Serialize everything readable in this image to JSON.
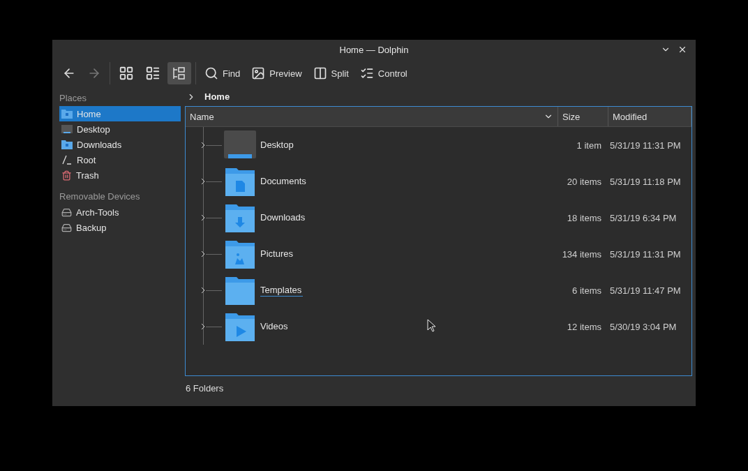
{
  "window": {
    "title": "Home — Dolphin"
  },
  "toolbar": {
    "nav": [
      {
        "kind": "back",
        "disabled": false
      },
      {
        "kind": "forward",
        "disabled": true
      }
    ],
    "views": [
      {
        "kind": "icons",
        "selected": false
      },
      {
        "kind": "compact",
        "selected": false
      },
      {
        "kind": "details",
        "selected": true
      }
    ],
    "actions": [
      {
        "kind": "find",
        "label": "Find"
      },
      {
        "kind": "preview",
        "label": "Preview"
      },
      {
        "kind": "split",
        "label": "Split"
      },
      {
        "kind": "control",
        "label": "Control"
      }
    ]
  },
  "sidebar": {
    "sections": [
      {
        "title": "Places",
        "items": [
          {
            "kind": "home",
            "label": "Home",
            "selected": true
          },
          {
            "kind": "desktop",
            "label": "Desktop",
            "selected": false
          },
          {
            "kind": "downloads",
            "label": "Downloads",
            "selected": false
          },
          {
            "kind": "root",
            "label": "Root",
            "selected": false
          },
          {
            "kind": "trash",
            "label": "Trash",
            "selected": false
          }
        ]
      },
      {
        "title": "Removable Devices",
        "items": [
          {
            "kind": "drive",
            "label": "Arch-Tools",
            "selected": false
          },
          {
            "kind": "drive",
            "label": "Backup",
            "selected": false
          }
        ]
      }
    ]
  },
  "breadcrumb": [
    "Home"
  ],
  "table": {
    "columns": [
      "Name",
      "Size",
      "Modified"
    ],
    "rows": [
      {
        "kind": "desktop",
        "name": "Desktop",
        "size": "1 item",
        "modified": "5/31/19 11:31 PM",
        "hovered": false
      },
      {
        "kind": "documents",
        "name": "Documents",
        "size": "20 items",
        "modified": "5/31/19 11:18 PM",
        "hovered": false
      },
      {
        "kind": "downloads",
        "name": "Downloads",
        "size": "18 items",
        "modified": "5/31/19 6:34 PM",
        "hovered": false
      },
      {
        "kind": "pictures",
        "name": "Pictures",
        "size": "134 items",
        "modified": "5/31/19 11:31 PM",
        "hovered": false
      },
      {
        "kind": "templates",
        "name": "Templates",
        "size": "6 items",
        "modified": "5/31/19 11:47 PM",
        "hovered": true
      },
      {
        "kind": "videos",
        "name": "Videos",
        "size": "12 items",
        "modified": "5/30/19 3:04 PM",
        "hovered": false
      }
    ]
  },
  "status_bar": "6 Folders"
}
